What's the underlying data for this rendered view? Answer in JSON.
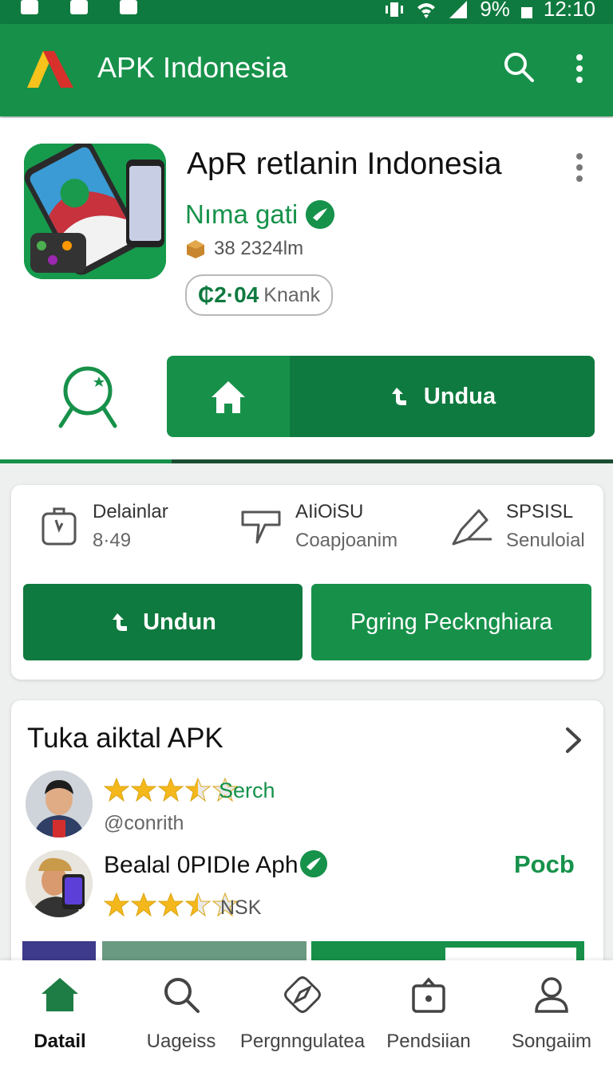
{
  "status_bar": {
    "battery": "9%",
    "time": "12:10"
  },
  "app_bar": {
    "title": "APK Indonesia"
  },
  "app": {
    "name": "ApR retlanin Indonesia",
    "developer": "Nıma gati",
    "meta": "38 2324lm",
    "rating_value": "₵2·04",
    "rating_label": "Knank"
  },
  "main_action": {
    "download_label": "Undua",
    "progress": 0.28
  },
  "info": {
    "items": [
      {
        "line1": "Delainlar",
        "line2": "8·49"
      },
      {
        "line1": "AIiOiSU",
        "line2": "Coapjoanim"
      },
      {
        "line1": "SPSISL",
        "line2": "Senuloial"
      }
    ],
    "download_button": "Undun",
    "secondary_button": "Pgring Pecknghiara"
  },
  "reviews": {
    "title": "Tuka aiktal APK",
    "items": [
      {
        "tag": "Serch",
        "handle": "@conrith",
        "stars": 3.5
      },
      {
        "name": "Bealal 0PIDIe Aph",
        "action": "Pocb",
        "tag": "NSK",
        "stars": 3.5
      }
    ]
  },
  "bottom_nav": {
    "items": [
      {
        "label": "Datail",
        "icon": "home-icon"
      },
      {
        "label": "Uageiss",
        "icon": "search-icon"
      },
      {
        "label": "Pergnngulatea",
        "icon": "compass-icon"
      },
      {
        "label": "Pendsiian",
        "icon": "bag-icon"
      },
      {
        "label": "Songaiim",
        "icon": "person-icon"
      }
    ]
  },
  "colors": {
    "primary": "#17914a",
    "primary_dark": "#0f7a3f",
    "star": "#f5b81c"
  }
}
